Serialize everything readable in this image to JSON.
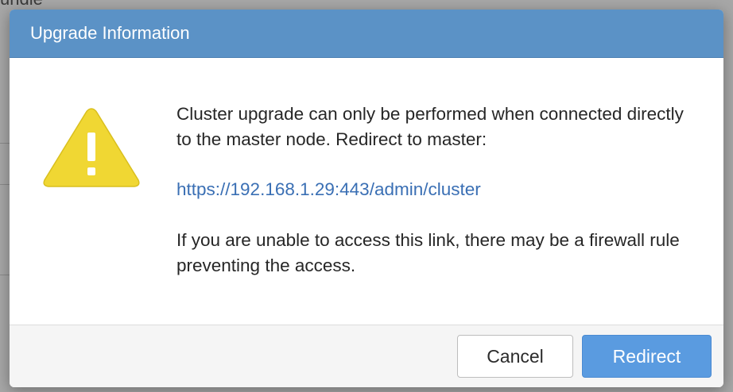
{
  "background": {
    "partial_text": "undle"
  },
  "dialog": {
    "title": "Upgrade Information",
    "icon": "warning-triangle-icon",
    "message": "Cluster upgrade can only be performed when connected directly to the master node. Redirect to master:",
    "link_text": "https://192.168.1.29:443/admin/cluster",
    "note": "If you are unable to access this link, there may be a firewall rule preventing the access.",
    "buttons": {
      "cancel_label": "Cancel",
      "redirect_label": "Redirect"
    }
  },
  "colors": {
    "header": "#5b92c6",
    "link": "#3a6fb4",
    "primary_button": "#5a9be0",
    "warning_fill": "#f0d733"
  }
}
